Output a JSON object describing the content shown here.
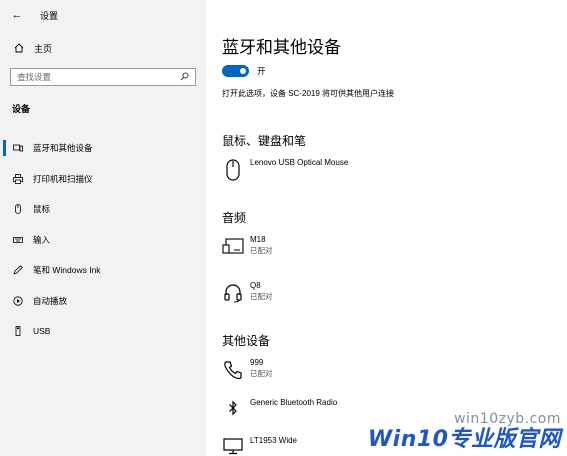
{
  "window": {
    "title": "设置"
  },
  "sidebar": {
    "home_label": "主页",
    "search_placeholder": "查找设置",
    "section_title": "设备",
    "items": [
      {
        "label": "蓝牙和其他设备",
        "icon": "bluetooth-devices-icon",
        "active": true
      },
      {
        "label": "打印机和扫描仪",
        "icon": "printer-icon"
      },
      {
        "label": "鼠标",
        "icon": "mouse-icon"
      },
      {
        "label": "输入",
        "icon": "keyboard-icon"
      },
      {
        "label": "笔和 Windows Ink",
        "icon": "pen-icon"
      },
      {
        "label": "自动播放",
        "icon": "autoplay-icon"
      },
      {
        "label": "USB",
        "icon": "usb-icon"
      }
    ]
  },
  "main": {
    "title": "蓝牙和其他设备",
    "bluetooth_toggle": {
      "state": "on",
      "label": "开"
    },
    "hint": "打开此选项，设备 SC-2019 将可供其他用户连接",
    "groups": [
      {
        "title": "鼠标、键盘和笔",
        "devices": [
          {
            "name": "Lenovo USB Optical Mouse",
            "status": "",
            "icon": "mouse-icon"
          }
        ]
      },
      {
        "title": "音频",
        "devices": [
          {
            "name": "M18",
            "status": "已配对",
            "icon": "audio-device-icon"
          },
          {
            "name": "Q8",
            "status": "已配对",
            "icon": "headset-icon"
          }
        ]
      },
      {
        "title": "其他设备",
        "devices": [
          {
            "name": "999",
            "status": "已配对",
            "icon": "phone-icon"
          },
          {
            "name": "Generic Bluetooth Radio",
            "status": "",
            "icon": "bluetooth-icon"
          },
          {
            "name": "LT1953 Wide",
            "status": "",
            "icon": "monitor-icon"
          }
        ]
      }
    ]
  },
  "watermark": {
    "url": "win10zyb.com",
    "brand": "Win10专业版官网"
  },
  "colors": {
    "accent": "#0067c0",
    "sidebar_bg": "#f2f2f2",
    "watermark_blue": "#1f57c8"
  }
}
